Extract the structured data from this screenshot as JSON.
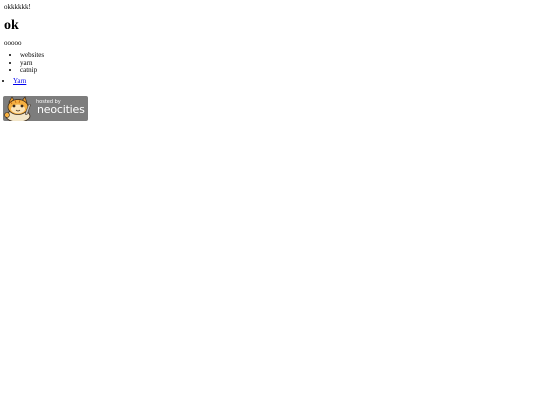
{
  "top_text": "okkkkkk!",
  "heading": "ok",
  "paragraph": "ooooo",
  "list_items": [
    "websites",
    "yarn",
    "catnip"
  ],
  "link": {
    "label": "Yarn"
  },
  "badge": {
    "small_text": "hosted by",
    "big_text": "neocities",
    "icon": "neocities-cat-icon"
  }
}
